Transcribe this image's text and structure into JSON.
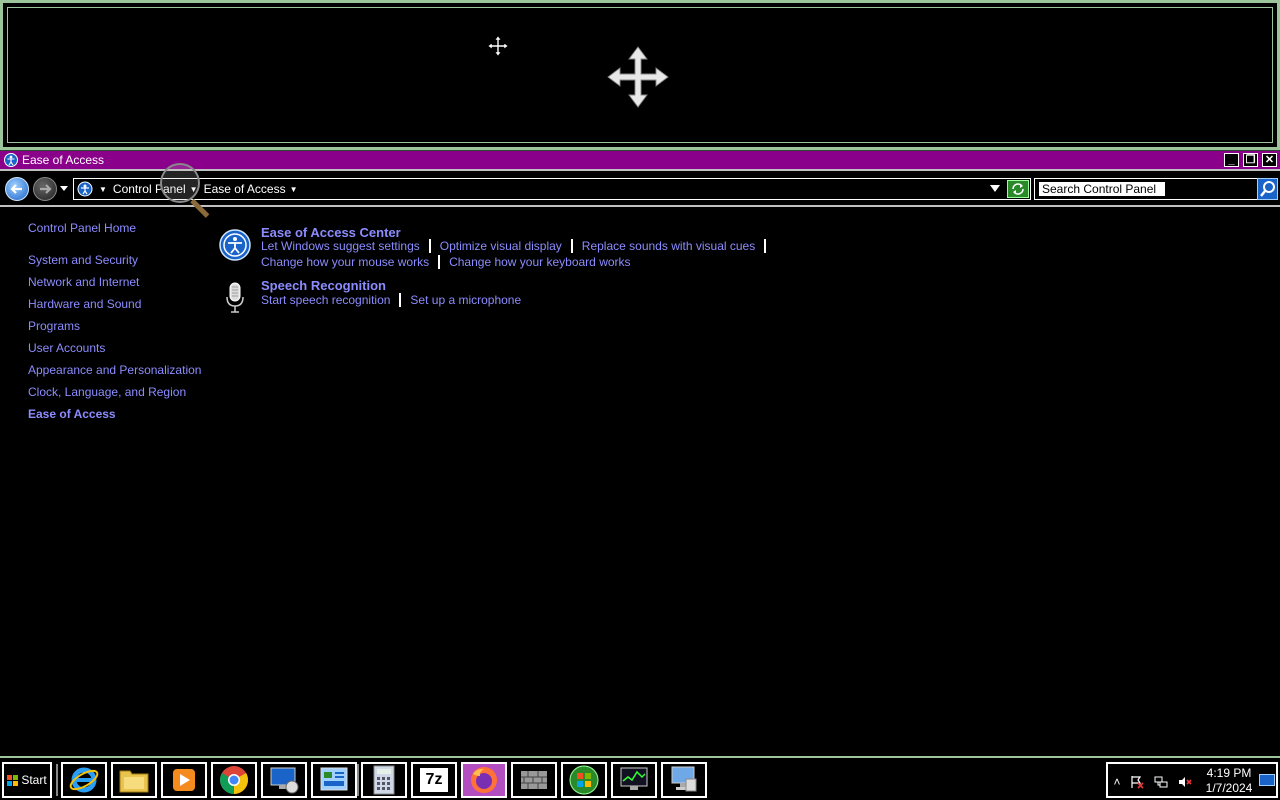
{
  "window": {
    "title": "Ease of Access",
    "buttons": {
      "minimize": "_",
      "restore": "❐",
      "close": "✕"
    }
  },
  "address_bar": {
    "crumbs": [
      "Control Panel",
      "Ease of Access"
    ],
    "search_value": "Search Control Panel"
  },
  "sidebar": {
    "home": "Control Panel Home",
    "items": [
      "System and Security",
      "Network and Internet",
      "Hardware and Sound",
      "Programs",
      "User Accounts",
      "Appearance and Personalization",
      "Clock, Language, and Region",
      "Ease of Access"
    ],
    "active_item": "Ease of Access"
  },
  "sections": [
    {
      "title": "Ease of Access Center",
      "icon": "ease-of-access-icon",
      "tasks_row1": [
        "Let Windows suggest settings",
        "Optimize visual display",
        "Replace sounds with visual cues"
      ],
      "tasks_row2": [
        "Change how your mouse works",
        "Change how your keyboard works"
      ]
    },
    {
      "title": "Speech Recognition",
      "icon": "microphone-icon",
      "tasks_row1": [
        "Start speech recognition",
        "Set up a microphone"
      ]
    }
  ],
  "taskbar": {
    "start_label": "Start",
    "apps": [
      "internet-explorer-icon",
      "file-explorer-icon",
      "media-player-icon",
      "chrome-icon",
      "remote-desktop-icon",
      "control-panel-icon",
      "calculator-icon",
      "7zip-icon",
      "firefox-icon",
      "firewall-icon",
      "windows-update-icon",
      "task-manager-icon",
      "network-computer-icon"
    ],
    "active_app": "firefox-icon",
    "seven_zip_label": "7z",
    "clock_time": "4:19 PM",
    "clock_date": "1/7/2024"
  },
  "colors": {
    "titlebar": "#8b008b",
    "link": "#8c8cff",
    "background": "#000000",
    "active_taskbar": "#b24ec0"
  }
}
